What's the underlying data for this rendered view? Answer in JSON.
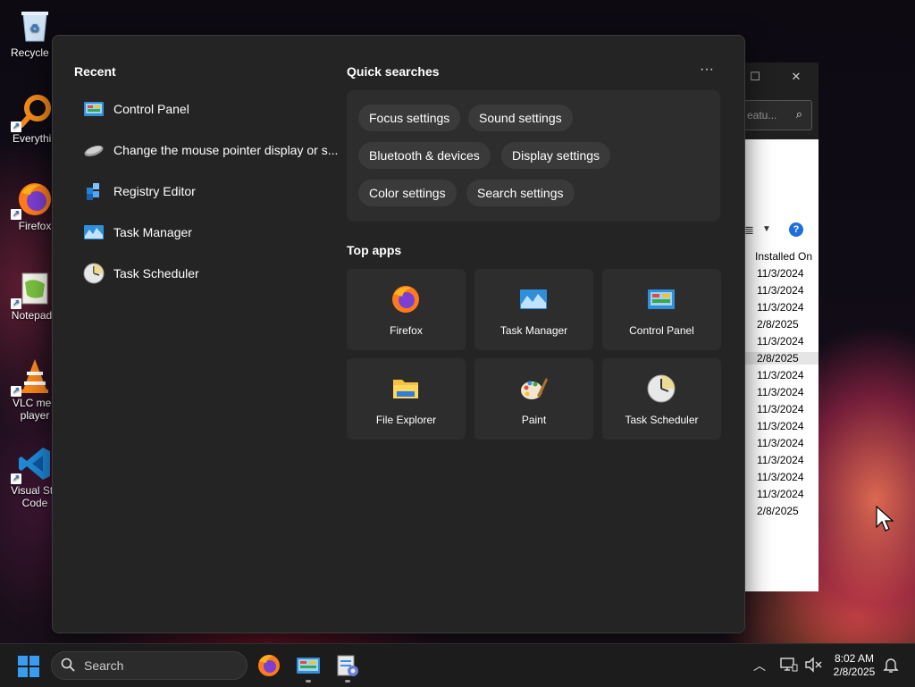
{
  "desktop": {
    "icons": [
      {
        "label": "Recycle B",
        "icon": "recycle-bin-icon"
      },
      {
        "label": "Everythin",
        "icon": "everything-search-icon"
      },
      {
        "label": "Firefox",
        "icon": "firefox-icon"
      },
      {
        "label": "Notepad+",
        "icon": "notepad-plus-plus-icon"
      },
      {
        "label": "VLC med player",
        "icon": "vlc-icon"
      },
      {
        "label": "Visual Stu Code",
        "icon": "vscode-icon"
      }
    ]
  },
  "background_window": {
    "search_placeholder": "eatu...",
    "column_header": "Installed On",
    "rows": [
      "11/3/2024",
      "11/3/2024",
      "11/3/2024",
      "2/8/2025",
      "11/3/2024",
      "2/8/2025",
      "11/3/2024",
      "11/3/2024",
      "11/3/2024",
      "11/3/2024",
      "11/3/2024",
      "11/3/2024",
      "11/3/2024",
      "11/3/2024",
      "2/8/2025"
    ],
    "selected_row": 5
  },
  "start_menu": {
    "recent_title": "Recent",
    "recent": [
      {
        "label": "Control Panel",
        "icon": "control-panel-icon"
      },
      {
        "label": "Change the mouse pointer display or s...",
        "icon": "mouse-icon"
      },
      {
        "label": "Registry Editor",
        "icon": "registry-editor-icon"
      },
      {
        "label": "Task Manager",
        "icon": "task-manager-icon"
      },
      {
        "label": "Task Scheduler",
        "icon": "task-scheduler-icon"
      }
    ],
    "quick_searches_title": "Quick searches",
    "more_label": "···",
    "quick_searches": [
      "Focus settings",
      "Sound settings",
      "Bluetooth & devices",
      "Display settings",
      "Color settings",
      "Search settings"
    ],
    "top_apps_title": "Top apps",
    "top_apps": [
      {
        "label": "Firefox",
        "icon": "firefox-icon"
      },
      {
        "label": "Task Manager",
        "icon": "task-manager-icon"
      },
      {
        "label": "Control Panel",
        "icon": "control-panel-icon"
      },
      {
        "label": "File Explorer",
        "icon": "file-explorer-icon"
      },
      {
        "label": "Paint",
        "icon": "paint-icon"
      },
      {
        "label": "Task Scheduler",
        "icon": "task-scheduler-icon"
      }
    ]
  },
  "taskbar": {
    "search_placeholder": "Search",
    "clock_time": "8:02 AM",
    "clock_date": "2/8/2025"
  },
  "colors": {
    "menu_bg": "#242424",
    "panel_bg": "#2d2d2d",
    "chip_bg": "#3a3a3a",
    "taskbar_bg": "#1c1c1c",
    "accent_blue": "#3a8ee6"
  }
}
